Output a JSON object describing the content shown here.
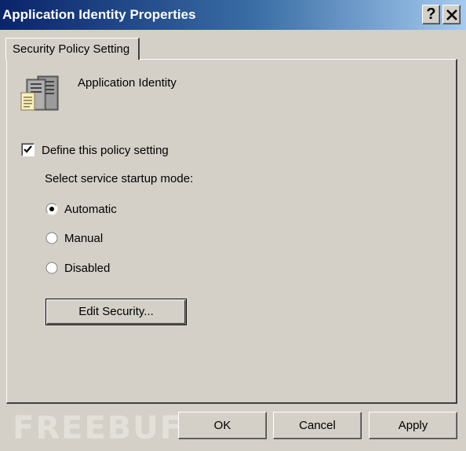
{
  "window": {
    "title": "Application Identity Properties",
    "help_label": "?",
    "close_label": "✕"
  },
  "tabs": [
    {
      "label": "Security Policy Setting",
      "selected": true
    }
  ],
  "policy": {
    "name": "Application Identity",
    "icon": "server-policy-icon"
  },
  "define_setting": {
    "label": "Define this policy setting",
    "checked": true
  },
  "startup_mode": {
    "label": "Select service startup mode:",
    "options": [
      {
        "label": "Automatic",
        "selected": true
      },
      {
        "label": "Manual",
        "selected": false
      },
      {
        "label": "Disabled",
        "selected": false
      }
    ]
  },
  "buttons": {
    "edit_security": "Edit Security...",
    "ok": "OK",
    "cancel": "Cancel",
    "apply": "Apply"
  },
  "watermark": "FREEBUF",
  "colors": {
    "dialog_bg": "#d4d0c8",
    "title_gradient_start": "#0a246a",
    "title_gradient_end": "#a6caf0",
    "title_text": "#ffffff"
  }
}
